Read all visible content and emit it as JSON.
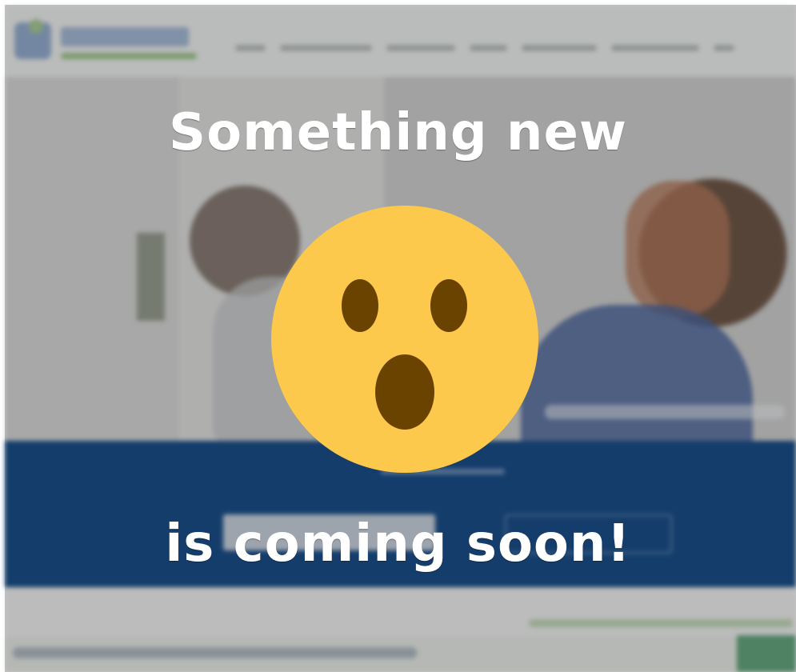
{
  "announcement": {
    "line1": "Something new",
    "line2": "is coming soon!"
  },
  "emoji": {
    "name": "surprised-face-icon",
    "color": "#FDC94C",
    "feature_color": "#6A4300"
  },
  "background": {
    "brand_color": "#1B4F8A",
    "accent_color": "#6FAA52"
  }
}
